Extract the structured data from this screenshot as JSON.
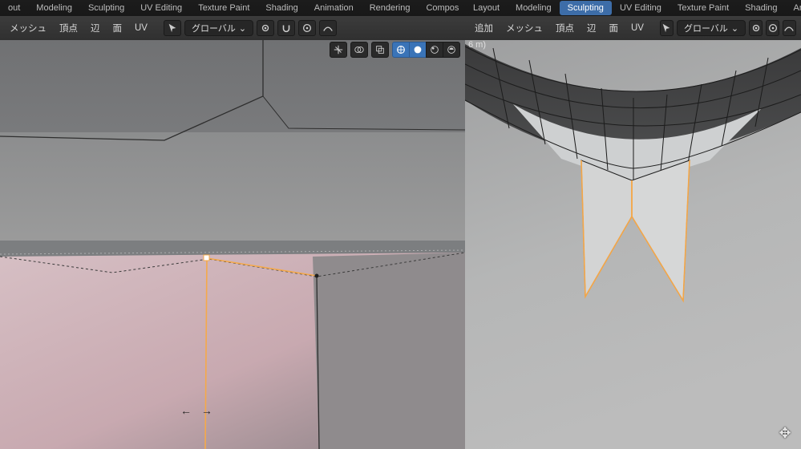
{
  "left": {
    "tabs": {
      "layout": "out",
      "modeling": "Modeling",
      "sculpting": "Sculpting",
      "uvedit": "UV Editing",
      "texpaint": "Texture Paint",
      "shading": "Shading",
      "animation": "Animation",
      "rendering": "Rendering",
      "compositing": "Compos"
    },
    "menus": {
      "mesh": "メッシュ",
      "vertex": "頂点",
      "edge": "辺",
      "face": "面",
      "uv": "UV"
    },
    "orientation": "グローバル",
    "orientation_chevron": "⌄",
    "hint_arrows": "←  →",
    "icons": {
      "cursor": "cursor-icon",
      "pivot": "pivot-icon",
      "snap": "snap-icon",
      "propedit": "proportional-edit-icon",
      "curve": "falloff-curve-icon",
      "gizmo": "gizmo-icon",
      "overlay": "overlay-icon",
      "xray": "xray-icon",
      "wire": "wireframe-shading-icon",
      "solid": "solid-shading-icon",
      "matprev": "material-preview-shading-icon",
      "rendered": "rendered-shading-icon"
    }
  },
  "right": {
    "tabs": {
      "layout": "Layout",
      "modeling": "Modeling",
      "sculpting": "Sculpting",
      "uvedit": "UV Editing",
      "texpaint": "Texture Paint",
      "shading": "Shading",
      "animation": "Animati"
    },
    "active_tab": "Sculpting",
    "menus": {
      "add": "追加",
      "mesh": "メッシュ",
      "vertex": "頂点",
      "edge": "辺",
      "face": "面",
      "uv": "UV"
    },
    "orientation": "グローバル",
    "orientation_chevron": "⌄",
    "status": "6 m)",
    "icons": {
      "cursor": "cursor-icon",
      "pivot": "pivot-icon",
      "propedit": "proportional-edit-icon",
      "curve": "falloff-curve-icon"
    }
  }
}
